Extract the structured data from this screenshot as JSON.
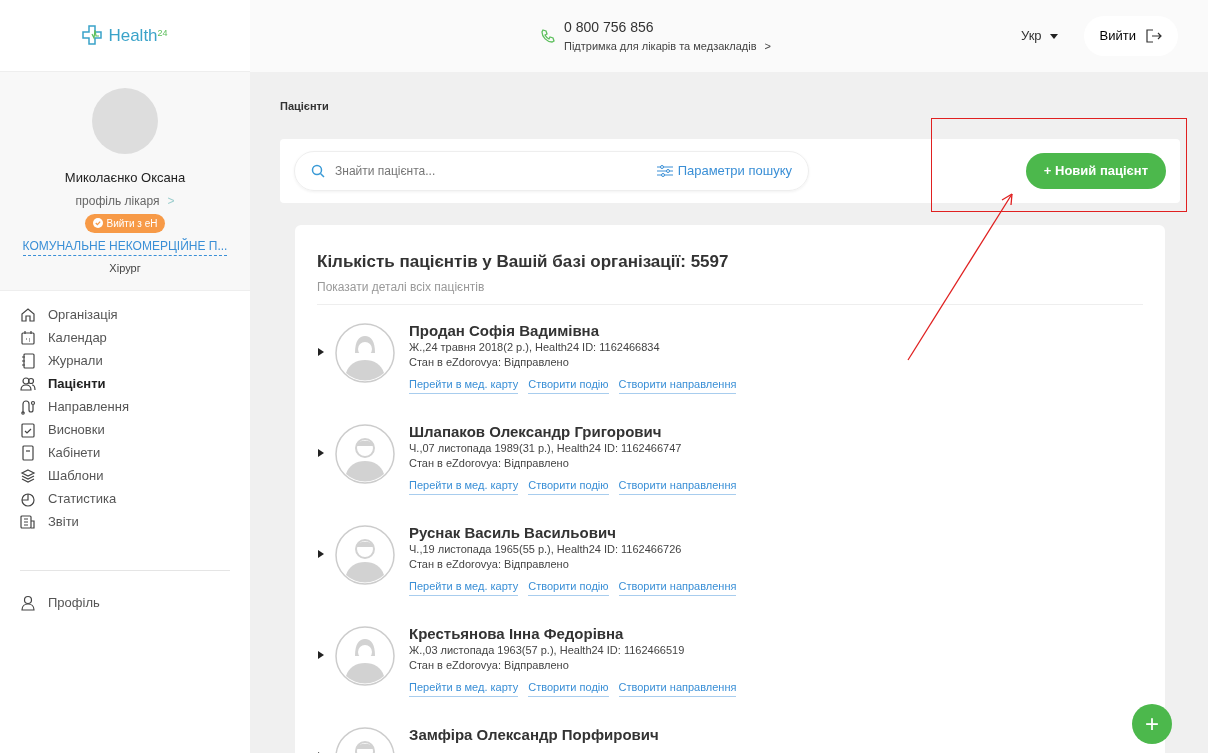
{
  "logo": {
    "text": "Health",
    "sup": "24"
  },
  "header": {
    "phone": "0 800 756 856",
    "support": "Підтримка для лікарів та медзакладів",
    "support_chevron": ">",
    "language": "Укр",
    "logout": "Вийти"
  },
  "profile": {
    "name": "Миколаєнко Оксана",
    "role_link": "профіль лікаря",
    "role_chevron": ">",
    "eh_button": "Вийти з еН",
    "organization": "КОМУНАЛЬНЕ НЕКОМЕРЦІЙНЕ П...",
    "specialty": "Хірург"
  },
  "sidebar": {
    "items": [
      {
        "label": "Організація",
        "selected": false
      },
      {
        "label": "Календар",
        "selected": false
      },
      {
        "label": "Журнали",
        "selected": false
      },
      {
        "label": "Пацієнти",
        "selected": true
      },
      {
        "label": "Направлення",
        "selected": false
      },
      {
        "label": "Висновки",
        "selected": false
      },
      {
        "label": "Кабінети",
        "selected": false
      },
      {
        "label": "Шаблони",
        "selected": false
      },
      {
        "label": "Статистика",
        "selected": false
      },
      {
        "label": "Звіти",
        "selected": false
      }
    ],
    "bottom_items": [
      {
        "label": "Профіль",
        "selected": false
      }
    ]
  },
  "page_title": "Пацієнти",
  "search": {
    "placeholder": "Знайти пацієнта...",
    "params": "Параметри пошуку"
  },
  "new_patient_button": "+ Новий пацієнт",
  "patients_card": {
    "title": "Кількість пацієнтів у Вашій базі організації: 5597",
    "show_details": "Показати деталі всіх пацієнтів",
    "patients": [
      {
        "kind": "female",
        "name": "Продан Софія Вадимівна",
        "info": "Ж.,24 травня 2018(2 р.), Health24 ID: 1162466834",
        "status": "Стан в eZdorovya: Відправлено",
        "links": [
          "Перейти в мед. карту",
          "Створити подію",
          "Створити направлення"
        ]
      },
      {
        "kind": "male",
        "name": "Шлапаков Олександр Григорович",
        "info": "Ч.,07 листопада 1989(31 р.), Health24 ID: 1162466747",
        "status": "Стан в eZdorovya: Відправлено",
        "links": [
          "Перейти в мед. карту",
          "Створити подію",
          "Створити направлення"
        ]
      },
      {
        "kind": "male",
        "name": "Руснак Василь Васильович",
        "info": "Ч.,19 листопада 1965(55 р.), Health24 ID: 1162466726",
        "status": "Стан в eZdorovya: Відправлено",
        "links": [
          "Перейти в мед. карту",
          "Створити подію",
          "Створити направлення"
        ]
      },
      {
        "kind": "female",
        "name": "Крестьянова Інна Федорівна",
        "info": "Ж.,03 листопада 1963(57 р.), Health24 ID: 1162466519",
        "status": "Стан в eZdorovya: Відправлено",
        "links": [
          "Перейти в мед. карту",
          "Створити подію",
          "Створити направлення"
        ]
      },
      {
        "kind": "male",
        "name": "Замфіра Олександр Порфирович"
      }
    ]
  },
  "fab": "+"
}
